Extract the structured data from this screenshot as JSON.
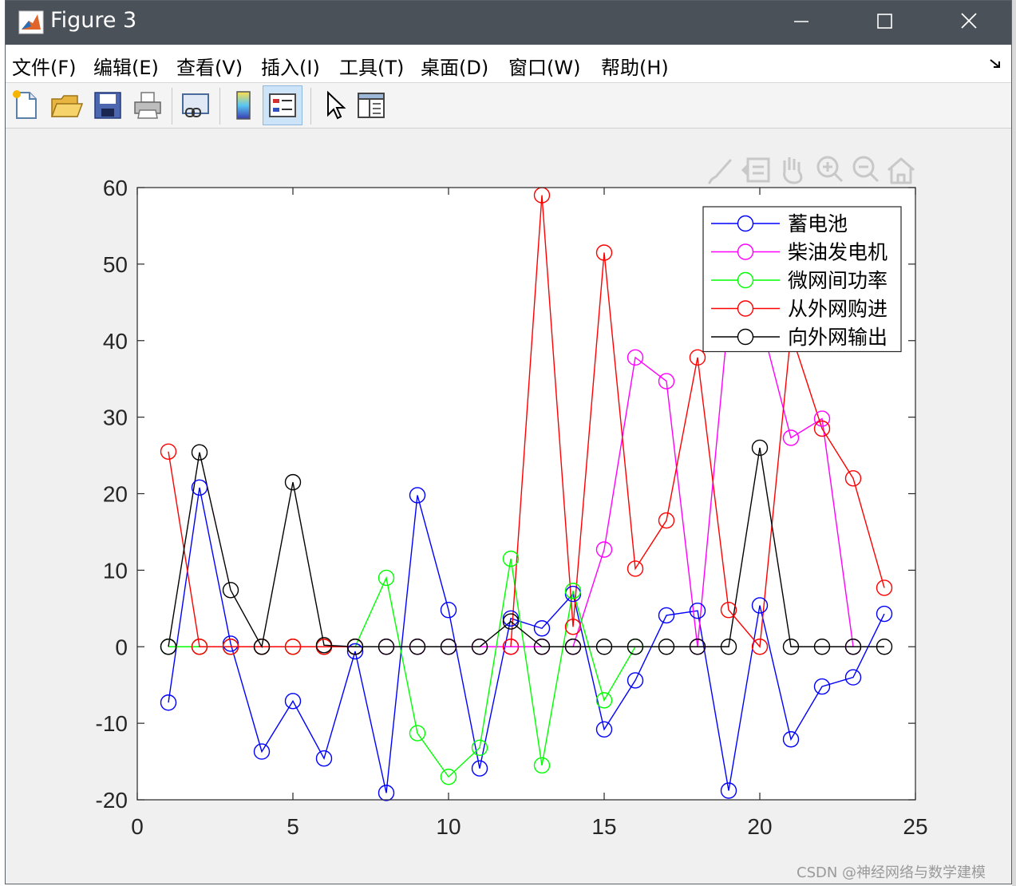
{
  "window": {
    "title": "Figure 3",
    "menu": [
      "文件(F)",
      "编辑(E)",
      "查看(V)",
      "插入(I)",
      "工具(T)",
      "桌面(D)",
      "窗口(W)",
      "帮助(H)"
    ],
    "toolbar_icons": [
      "new-figure-icon",
      "open-file-icon",
      "save-icon",
      "print-icon",
      "link-plot-icon",
      "colorbar-icon",
      "legend-icon",
      "pointer-icon",
      "property-editor-icon"
    ],
    "axes_toolbar_icons": [
      "brush-icon",
      "data-tip-icon",
      "pan-icon",
      "zoom-in-icon",
      "zoom-out-icon",
      "home-icon"
    ]
  },
  "watermark": "CSDN @神经网络与数学建模",
  "chart_data": {
    "type": "line",
    "title": "",
    "xlabel": "",
    "ylabel": "",
    "xlim": [
      0,
      25
    ],
    "ylim": [
      -20,
      60
    ],
    "xticks": [
      0,
      5,
      10,
      15,
      20,
      25
    ],
    "yticks": [
      -20,
      -10,
      0,
      10,
      20,
      30,
      40,
      50,
      60
    ],
    "grid": false,
    "legend_position": "top-right",
    "marker": "circle",
    "x": [
      1,
      2,
      3,
      4,
      5,
      6,
      7,
      8,
      9,
      10,
      11,
      12,
      13,
      14,
      15,
      16,
      17,
      18,
      19,
      20,
      21,
      22,
      23,
      24
    ],
    "series": [
      {
        "name": "蓄电池",
        "color": "#0000ff",
        "values": [
          -7.3,
          20.8,
          0.4,
          -13.7,
          -7.1,
          -14.6,
          -0.6,
          -19.1,
          19.8,
          4.8,
          -15.9,
          3.7,
          2.4,
          6.9,
          -10.8,
          -4.4,
          4.1,
          4.7,
          -18.8,
          5.4,
          -12.1,
          -5.2,
          -4.0,
          4.3
        ]
      },
      {
        "name": "柴油发电机",
        "color": "#ff00ff",
        "values": [
          0,
          0,
          0,
          0,
          0,
          0,
          0,
          0,
          0,
          0,
          0,
          0,
          0,
          0,
          12.7,
          37.8,
          34.7,
          0,
          43.5,
          43.0,
          27.3,
          29.8,
          0,
          null
        ]
      },
      {
        "name": "微网间功率",
        "color": "#00ff00",
        "values": [
          0,
          0,
          0,
          0,
          0,
          0,
          0,
          9.0,
          -11.3,
          -17.0,
          -13.2,
          11.5,
          -15.5,
          7.3,
          -7.0,
          0,
          null,
          null,
          null,
          null,
          null,
          null,
          null,
          null
        ]
      },
      {
        "name": "从外网购进",
        "color": "#ff0000",
        "values": [
          25.5,
          0,
          0,
          0,
          0,
          0,
          0,
          null,
          null,
          null,
          null,
          0,
          59.0,
          2.6,
          51.5,
          10.2,
          16.5,
          37.8,
          4.8,
          0,
          41.0,
          28.5,
          22.0,
          7.7
        ]
      },
      {
        "name": "向外网输出",
        "color": "#000000",
        "values": [
          0,
          25.4,
          7.4,
          0,
          21.5,
          0.2,
          0,
          0,
          0,
          0,
          0,
          3.3,
          0,
          0,
          0,
          0,
          0,
          0,
          0,
          26.0,
          0,
          0,
          0,
          0
        ]
      }
    ]
  }
}
